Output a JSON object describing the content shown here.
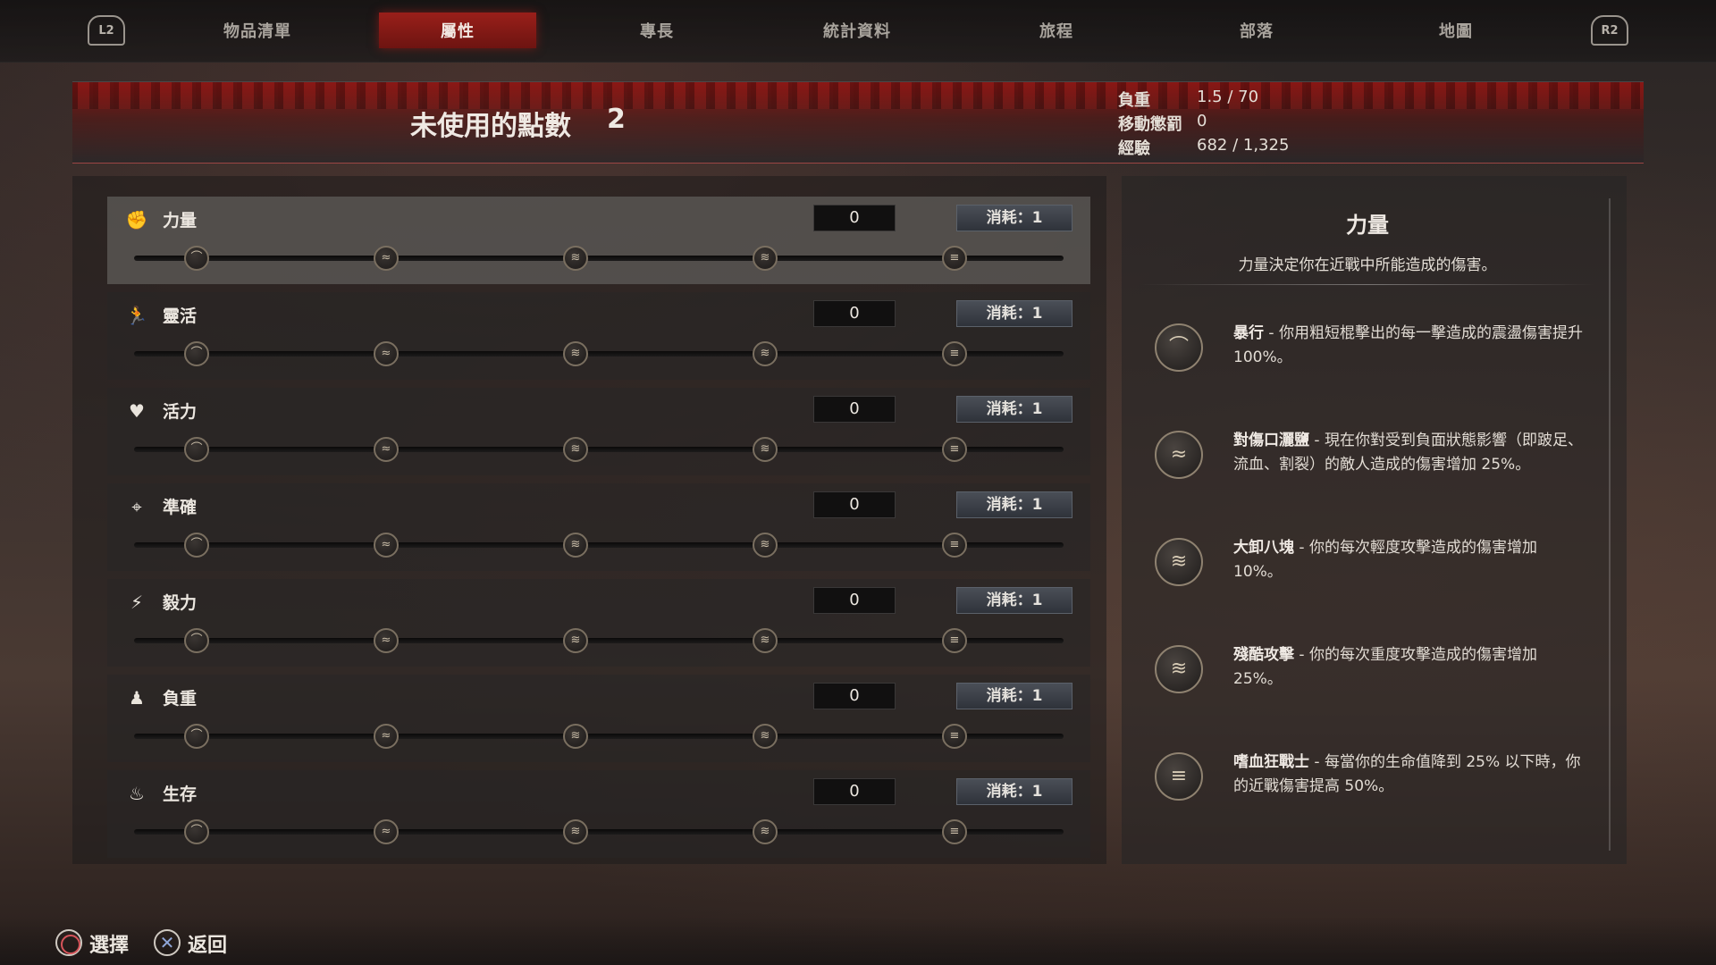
{
  "nav": {
    "left_shoulder": "L2",
    "right_shoulder": "R2",
    "tabs": [
      {
        "label": "物品清單"
      },
      {
        "label": "屬性"
      },
      {
        "label": "專長"
      },
      {
        "label": "統計資料"
      },
      {
        "label": "旅程"
      },
      {
        "label": "部落"
      },
      {
        "label": "地圖"
      }
    ],
    "active_tab": "屬性"
  },
  "header": {
    "unused_points_label": "未使用的點數",
    "unused_points_value": "2",
    "stats": [
      {
        "label": "負重",
        "value": "1.5 / 70"
      },
      {
        "label": "移動懲罰",
        "value": "0"
      },
      {
        "label": "經驗",
        "value": "682 / 1,325"
      }
    ]
  },
  "attributes": [
    {
      "name": "力量",
      "icon": "fist-icon",
      "value": "0",
      "cost": "消耗：1",
      "selected": true
    },
    {
      "name": "靈活",
      "icon": "running-figure-icon",
      "value": "0",
      "cost": "消耗：1",
      "selected": false
    },
    {
      "name": "活力",
      "icon": "heart-icon",
      "value": "0",
      "cost": "消耗：1",
      "selected": false
    },
    {
      "name": "準確",
      "icon": "crosshair-icon",
      "value": "0",
      "cost": "消耗：1",
      "selected": false
    },
    {
      "name": "毅力",
      "icon": "lightning-figure-icon",
      "value": "0",
      "cost": "消耗：1",
      "selected": false
    },
    {
      "name": "負重",
      "icon": "weight-icon",
      "value": "0",
      "cost": "消耗：1",
      "selected": false
    },
    {
      "name": "生存",
      "icon": "campfire-icon",
      "value": "0",
      "cost": "消耗：1",
      "selected": false
    }
  ],
  "detail": {
    "title": "力量",
    "description": "力量決定你在近戰中所能造成的傷害。",
    "perks": [
      {
        "name": "暴行",
        "text": " - 你用粗短棍擊出的每一擊造成的震盪傷害提升 100%。",
        "icon": "perk-tier1-icon"
      },
      {
        "name": "對傷口灑鹽",
        "text": " - 現在你對受到負面狀態影響（即跛足、流血、割裂）的敵人造成的傷害增加 25%。",
        "icon": "perk-tier2-icon"
      },
      {
        "name": "大卸八塊",
        "text": " - 你的每次輕度攻擊造成的傷害增加 10%。",
        "icon": "perk-tier3-icon"
      },
      {
        "name": "殘酷攻擊",
        "text": " - 你的每次重度攻擊造成的傷害增加 25%。",
        "icon": "perk-tier4-icon"
      },
      {
        "name": "嗜血狂戰士",
        "text": " - 每當你的生命值降到 25% 以下時，你的近戰傷害提高 50%。",
        "icon": "perk-tier5-icon"
      }
    ]
  },
  "footer": {
    "select_label": "選擇",
    "back_label": "返回"
  }
}
